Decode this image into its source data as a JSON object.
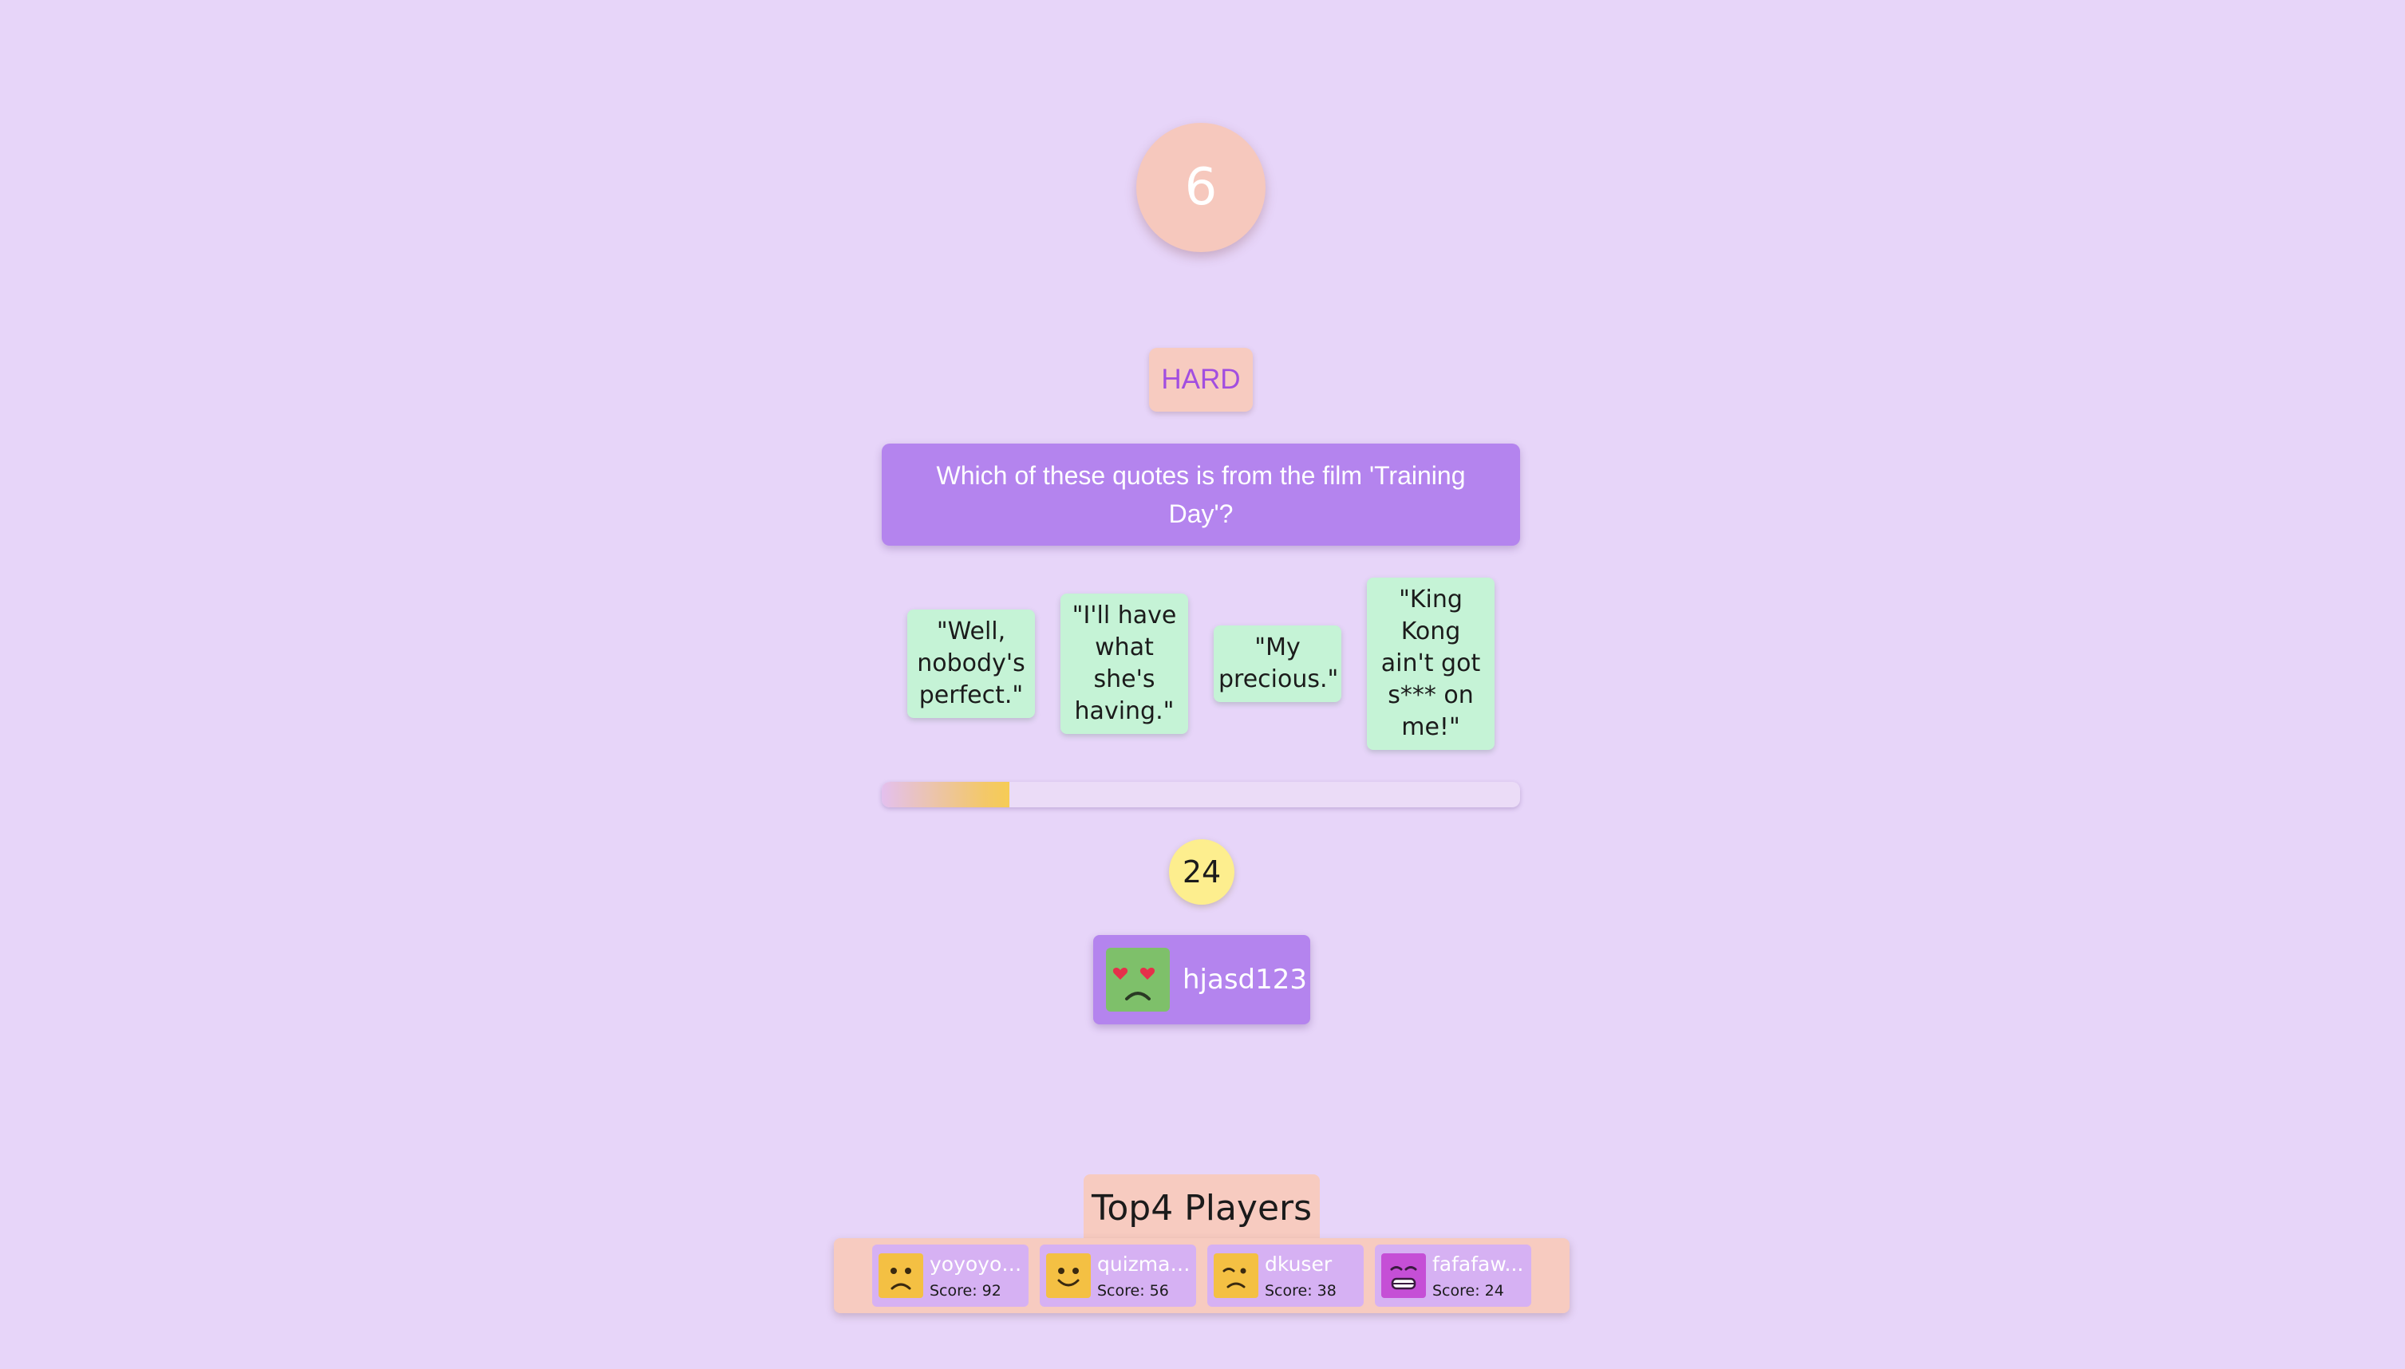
{
  "game": {
    "question_number": "6",
    "difficulty": "HARD",
    "question": "Which of these quotes is from the film 'Training Day'?",
    "answers": [
      "\"Well, nobody's perfect.\"",
      "\"I'll have what she's having.\"",
      "\"My precious.\"",
      "\"King Kong ain't got s*** on me!\""
    ],
    "timer_remaining_fraction": 0.2,
    "score": "24"
  },
  "player": {
    "name": "hjasd123",
    "avatar_icon": "heart-eyes-face-icon",
    "avatar_color": "#7ec06a"
  },
  "top_players": {
    "title": "Top4 Players",
    "score_label": "Score:",
    "players": [
      {
        "name": "yoyoyo1...",
        "score": "92",
        "icon": "sad-face-icon",
        "color": "#f4c043"
      },
      {
        "name": "quizmas...",
        "score": "56",
        "icon": "smile-face-icon",
        "color": "#f4c043"
      },
      {
        "name": "dkuser",
        "score": "38",
        "icon": "sleepy-face-icon",
        "color": "#f4c043"
      },
      {
        "name": "fafafaw...",
        "score": "24",
        "icon": "grimace-face-icon",
        "color": "#c54fd6"
      }
    ]
  },
  "colors": {
    "background": "#e7d5f9",
    "accent_purple": "#b484ee",
    "peach": "#f7cbc0",
    "answer_green": "#c5f3d6",
    "score_yellow": "#fdee8e"
  }
}
